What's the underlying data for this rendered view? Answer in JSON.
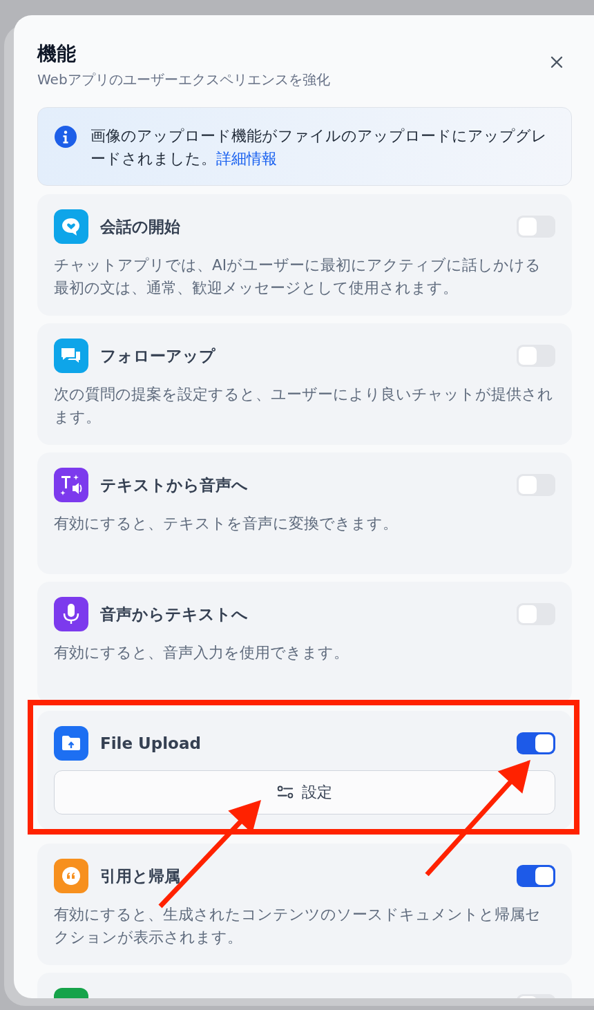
{
  "dialog": {
    "title": "機能",
    "subtitle": "Webアプリのユーザーエクスペリエンスを強化"
  },
  "notice": {
    "text": "画像のアップロード機能がファイルのアップロードにアップグレードされました。",
    "link": "詳細情報"
  },
  "features": [
    {
      "kind": "basic",
      "color": "#0ea5e9",
      "title": "会話の開始",
      "description": "チャットアプリでは、AIがユーザーに最初にアクティブに話しかける最初の文は、通常、歓迎メッセージとして使用されます。",
      "on": false
    },
    {
      "kind": "basic",
      "color": "#0ea5e9",
      "title": "フォローアップ",
      "description": "次の質問の提案を設定すると、ユーザーにより良いチャットが提供されます。",
      "on": false
    },
    {
      "kind": "basic",
      "color": "#7c3aed",
      "title": "テキストから音声へ",
      "description": "有効にすると、テキストを音声に変換できます。",
      "on": false
    },
    {
      "kind": "basic",
      "color": "#7c3aed",
      "title": "音声からテキストへ",
      "description": "有効にすると、音声入力を使用できます。",
      "on": false
    },
    {
      "kind": "settings",
      "color": "#1d6ff2",
      "title": "File Upload",
      "button": "設定",
      "on": true
    },
    {
      "kind": "basic",
      "color": "#f7901e",
      "title": "引用と帰属",
      "description": "有効にすると、生成されたコンテンツのソースドキュメントと帰属セクションが表示されます。",
      "on": true
    },
    {
      "kind": "partial",
      "color": "#16a34a",
      "on": false
    }
  ],
  "annotations": [
    {
      "kind": "highlight_box"
    },
    {
      "kind": "arrow"
    },
    {
      "kind": "arrow"
    }
  ]
}
